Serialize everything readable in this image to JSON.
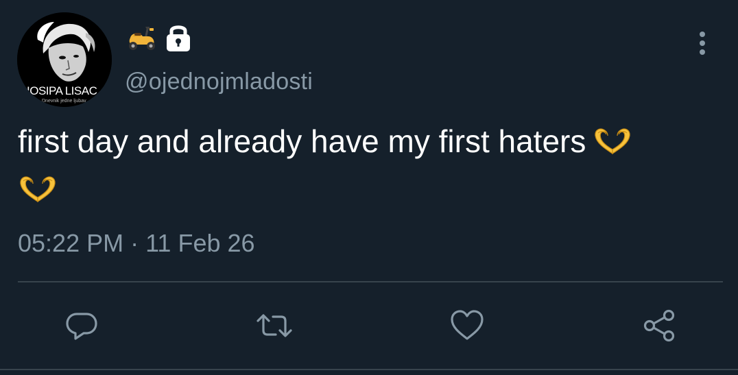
{
  "header": {
    "avatar_name": "IOSIPA LISAC",
    "avatar_subtitle": "Dnevnik jedne ljubav",
    "badge_emojis": [
      "motor-scooter-icon",
      "lock-icon"
    ],
    "handle": "@ojednojmladosti"
  },
  "tweet": {
    "text": "first day and already have my first haters",
    "emoji": "heart-hands-icon",
    "emoji_count": 2,
    "timestamp": "05:22 PM · 11 Feb 26"
  },
  "actions": [
    {
      "name": "reply",
      "icon": "reply-icon"
    },
    {
      "name": "retweet",
      "icon": "retweet-icon"
    },
    {
      "name": "like",
      "icon": "heart-icon"
    },
    {
      "name": "share",
      "icon": "share-icon"
    }
  ],
  "colors": {
    "background": "#15202b",
    "text": "#ffffff",
    "secondary": "#8899a6",
    "divider": "#38444d"
  }
}
